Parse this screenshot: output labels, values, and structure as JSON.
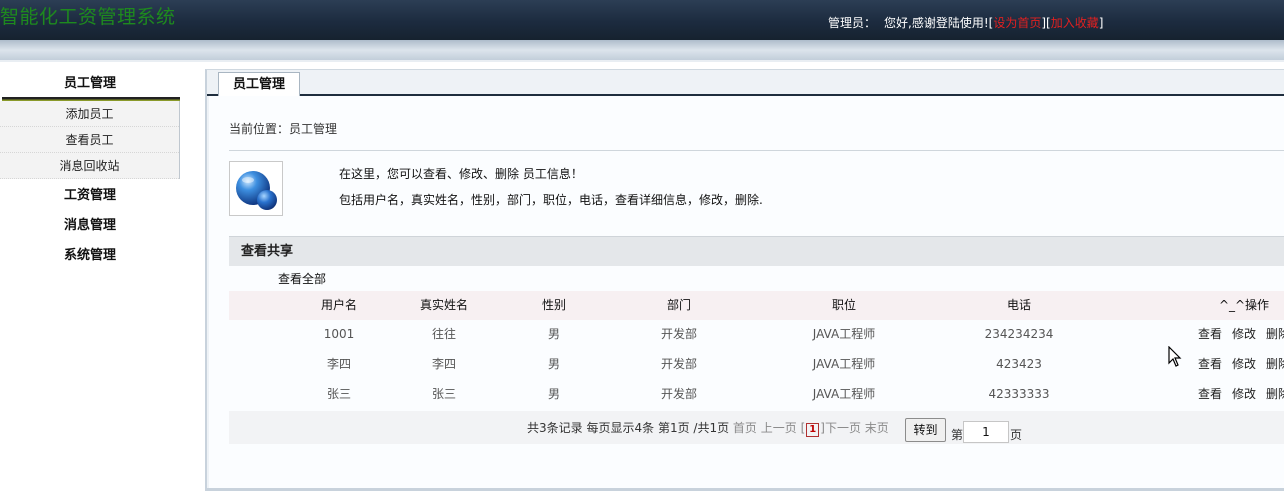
{
  "header": {
    "system_title": "智能化工资管理系统",
    "slogan": "",
    "admin_label": "管理员：",
    "welcome_text": "您好,感谢登陆使用!",
    "set_home_link": "设为首页",
    "add_favorite_link": "加入收藏",
    "bracket_open": "[",
    "bracket_close": "]"
  },
  "sidebar": {
    "menus": [
      {
        "label": "员工管理",
        "items": [
          {
            "label": "添加员工"
          },
          {
            "label": "查看员工"
          },
          {
            "label": "消息回收站"
          }
        ]
      },
      {
        "label": "工资管理"
      },
      {
        "label": "消息管理"
      },
      {
        "label": "系统管理"
      }
    ]
  },
  "main": {
    "tab_label": "员工管理",
    "breadcrumb": "当前位置：员工管理",
    "intro_line1": "在这里，您可以查看、修改、删除 员工信息！",
    "intro_line2": "包括用户名，真实姓名，性别，部门，职位，电话，查看详细信息，修改，删除.",
    "section_title": "查看共享",
    "view_all": "查看全部"
  },
  "table": {
    "headers": [
      "用户名",
      "真实姓名",
      "性别",
      "部门",
      "职位",
      "电话",
      "^_^操作"
    ],
    "rows": [
      {
        "cells": [
          "1001",
          "往往",
          "男",
          "开发部",
          "JAVA工程师",
          "234234234"
        ],
        "actions": [
          "查看",
          "修改",
          "删除"
        ]
      },
      {
        "cells": [
          "李四",
          "李四",
          "男",
          "开发部",
          "JAVA工程师",
          "423423"
        ],
        "actions": [
          "查看",
          "修改",
          "删除"
        ]
      },
      {
        "cells": [
          "张三",
          "张三",
          "男",
          "开发部",
          "JAVA工程师",
          "42333333"
        ],
        "actions": [
          "查看",
          "修改",
          "删除"
        ]
      }
    ]
  },
  "pager": {
    "total_text": "共3条记录",
    "per_page_text": "每页显示4条",
    "current_text": "第1页",
    "total_pages_text": "/共1页",
    "first_label": "首页",
    "prev_label": "上一页",
    "current_page": "1",
    "next_label": "下一页",
    "last_label": "末页",
    "goto_label": "转到",
    "page_prefix": "第",
    "page_suffix": "页",
    "page_input_value": "1"
  },
  "colors": {
    "banner": "#1c2b3f",
    "title_green": "#1e8a1e",
    "link_red": "#e02020",
    "table_header_bg": "#f7f0f2"
  }
}
